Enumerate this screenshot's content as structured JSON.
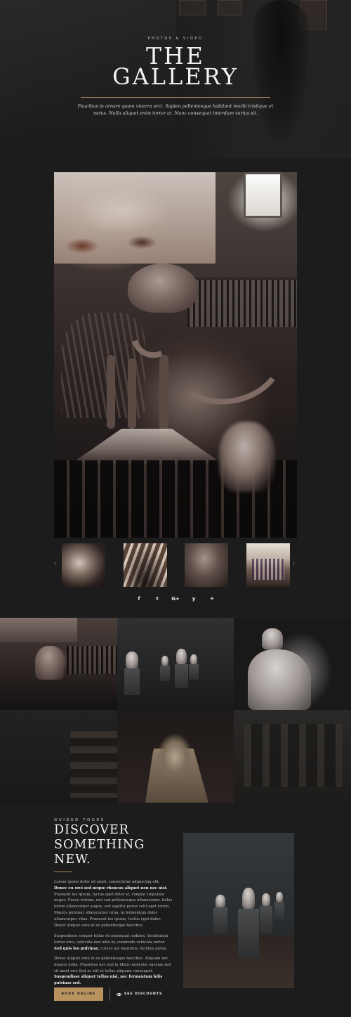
{
  "hero": {
    "kicker": "PHOTOS & VIDEO",
    "title_line1": "THE",
    "title_line2": "GALLERY",
    "description": "Faucibus in ornare quam viverra orci. Sapien pellentesque habitant morbi tristique et netus. Nulla aliquet enim tortor at. Nunc consequat interdum varius sit."
  },
  "gallery": {
    "prev_icon": "‹",
    "next_icon": "›",
    "thumbnails": [
      "thumbnail-1",
      "thumbnail-2",
      "thumbnail-3",
      "thumbnail-4"
    ]
  },
  "social": {
    "facebook": "f",
    "twitter": "t",
    "google_plus": "G+",
    "yelp": "y",
    "telegram": "✈"
  },
  "discover": {
    "kicker": "GUIDED TOURS",
    "title_line1": "DISCOVER",
    "title_line2": "SOMETHING",
    "title_line3": "NEW.",
    "p1_a": "Lorem ipsum dolor sit amet, consectetur adipiscing elit. ",
    "p1_b": "Donec eu orci sed neque rhoncus aliquet non nec nisi.",
    "p1_c": " Praesent leo ipsum, luctus eget dolor et, congue vulputate augue. Fusce rutrum, nisi sed pellentesque ullamcorper, tellus lorem ullamcorper augue, sed sagittis purus velit eget lorem. Mauris pulvinar ullamcorper urna, in fermentum dolor ullamcorper vitae. Praesent leo ipsum, luctus eget dolor. Donec aliquet ante et ex pellentesque faucibus.",
    "p2_a": "Suspendisse semper tellus et consequat sodales. Vestibulum tortor eros, vehicula non odio id, commodo vehicula tortor. ",
    "p2_b": "Sed quis leo pulvinar,",
    "p2_c": " cursus est maximus, facilisis purus.",
    "p3_a": "Donec aliquet ante et ex pellentesque faucibus. Aliquam nec mauris nulla. Phasellus nec nisl in libero molestie egestas sed sit amet orci.Sed ac elit et tellus aliquam consequat. ",
    "p3_b": "Suspendisse aliquet tellus nisi, nec fermentum felis pulvinar sed.",
    "book_button": "BOOK ONLINE",
    "discounts_button": "SEE DISCOUNTS"
  },
  "colors": {
    "background": "#1c1c1d",
    "accent_gold": "#b8935f",
    "text_light": "#f2f2f2"
  }
}
